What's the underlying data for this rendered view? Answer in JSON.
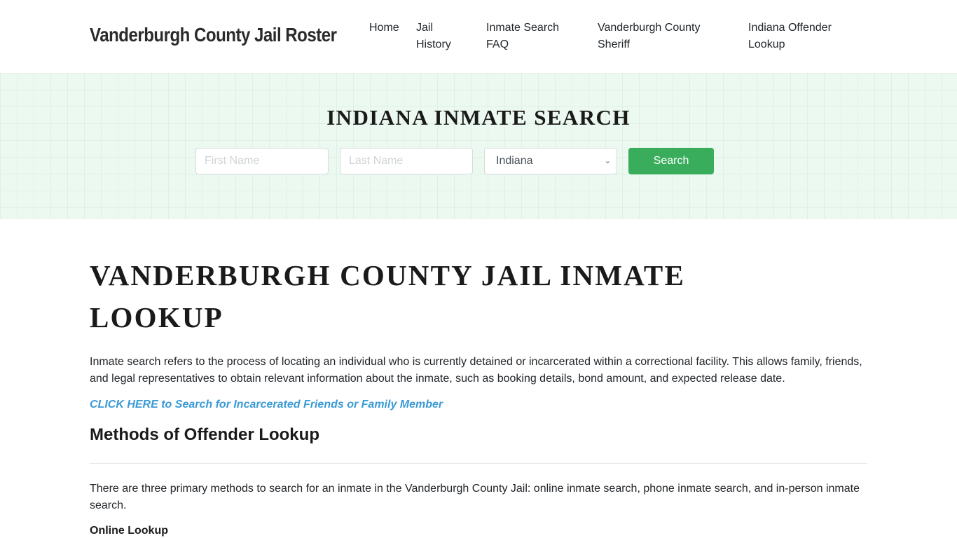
{
  "header": {
    "brand": "Vanderburgh County Jail Roster",
    "nav": [
      {
        "label": "Home"
      },
      {
        "label": "Jail History"
      },
      {
        "label": "Inmate Search FAQ"
      },
      {
        "label": "Vanderburgh County Sheriff"
      },
      {
        "label": "Indiana Offender Lookup"
      }
    ]
  },
  "search": {
    "title": "INDIANA INMATE SEARCH",
    "first_name_placeholder": "First Name",
    "last_name_placeholder": "Last Name",
    "state_selected": "Indiana",
    "button_label": "Search",
    "button_color": "#3aad5c"
  },
  "main": {
    "title": "VANDERBURGH COUNTY JAIL INMATE LOOKUP",
    "intro": "Inmate search refers to the process of locating an individual who is currently detained or incarcerated within a correctional facility. This allows family, friends, and legal representatives to obtain relevant information about the inmate, such as booking details, bond amount, and expected release date.",
    "cta_link": "CLICK HERE to Search for Incarcerated Friends or Family Member",
    "section_heading": "Methods of Offender Lookup",
    "methods_text": "There are three primary methods to search for an inmate in the Vanderburgh County Jail: online inmate search, phone inmate search, and in-person inmate search.",
    "subheading": "Online Lookup"
  }
}
